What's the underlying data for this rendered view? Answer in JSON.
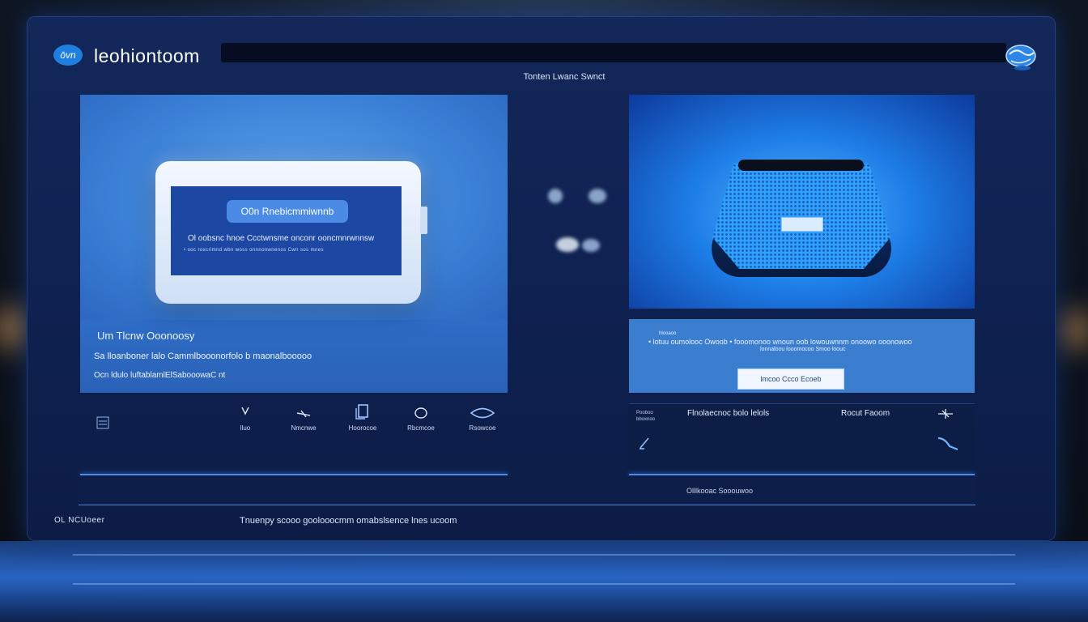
{
  "header": {
    "logo_text": "ōvn",
    "app_title": "leohiontoom",
    "center_caption": "Tonten Lwanc Swnct"
  },
  "left_panel": {
    "screen_pill": "O0n Rnebicmmiwnnb",
    "screen_line1": "Ol oobsnc hnoe  Ccctwnsme onconr  ooncmnrwnnsw",
    "screen_line2": "• ooc roxcrimnd wbn woss onnnonwnenos Cwn  sos mnes",
    "heading": "Um  Tlcnw  Ooonoosy",
    "line1": "Sa  lloanboner  lalo  Cammlbooonorfolo b  maonalbooooo",
    "line2": "Ocn ldulo luftablamlElSabooowaC nt"
  },
  "toolbar": {
    "tools": [
      {
        "label": "lluo"
      },
      {
        "label": "Nmcnwe"
      },
      {
        "label": "Hoorocoe"
      },
      {
        "label": "Rbcmcoe"
      },
      {
        "label": "Rsowcoe"
      }
    ]
  },
  "right_panel": {
    "info_tag": "hlooaoo",
    "info_line1": "• lotuu oumolooc   Owoob  • fooomonoo wnoun oob lowouwnnm  onoowo  ooonowoo",
    "info_line2": "lonnaloou  looomocoo  Smoo loouc",
    "info_button": "lmcoo Ccco  Ecoeb",
    "lower_tiny": "Pooboo\nbboxnoo",
    "lower_title": "Flnolaecnoc bolo  lelols",
    "lower_right": "Rocut  Faoom"
  },
  "band_text": "Olllkooac  Sooouwoo",
  "footer": {
    "left": "OL  NCUoeer",
    "center": "Tnuenpy  scooo  goolooocmm  omabslsence  lnes  ucoom"
  },
  "colors": {
    "window_bg": "#13275a",
    "panel_blue": "#3b7ed6",
    "accent": "#4d8de8",
    "button_bg": "#f2f7ff"
  }
}
